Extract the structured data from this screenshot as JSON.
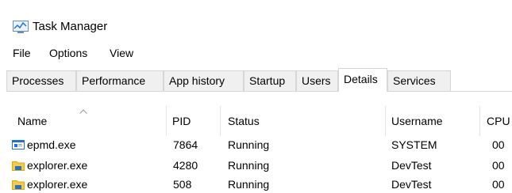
{
  "window": {
    "title": "Task Manager",
    "icon": "task-manager-icon"
  },
  "menu": {
    "items": [
      "File",
      "Options",
      "View"
    ]
  },
  "tabs": {
    "items": [
      "Processes",
      "Performance",
      "App history",
      "Startup",
      "Users",
      "Details",
      "Services"
    ],
    "active": "Details"
  },
  "table": {
    "sorted_column": "Name",
    "sort_direction": "ascending",
    "headers": {
      "name": "Name",
      "pid": "PID",
      "status": "Status",
      "username": "Username",
      "cpu": "CPU"
    },
    "rows": [
      {
        "icon": "application-window-icon",
        "name": "epmd.exe",
        "pid": "7864",
        "status": "Running",
        "username": "SYSTEM",
        "cpu": "00"
      },
      {
        "icon": "folder-icon",
        "name": "explorer.exe",
        "pid": "4280",
        "status": "Running",
        "username": "DevTest",
        "cpu": "00"
      },
      {
        "icon": "folder-icon",
        "name": "explorer.exe",
        "pid": "508",
        "status": "Running",
        "username": "DevTest",
        "cpu": "00"
      }
    ]
  },
  "colors": {
    "icon_blue": "#1e73d2",
    "folder_yellow": "#f7c948",
    "folder_dark": "#e0a800",
    "border": "#d6d6d6",
    "tab_bg": "#f0f0f0"
  }
}
